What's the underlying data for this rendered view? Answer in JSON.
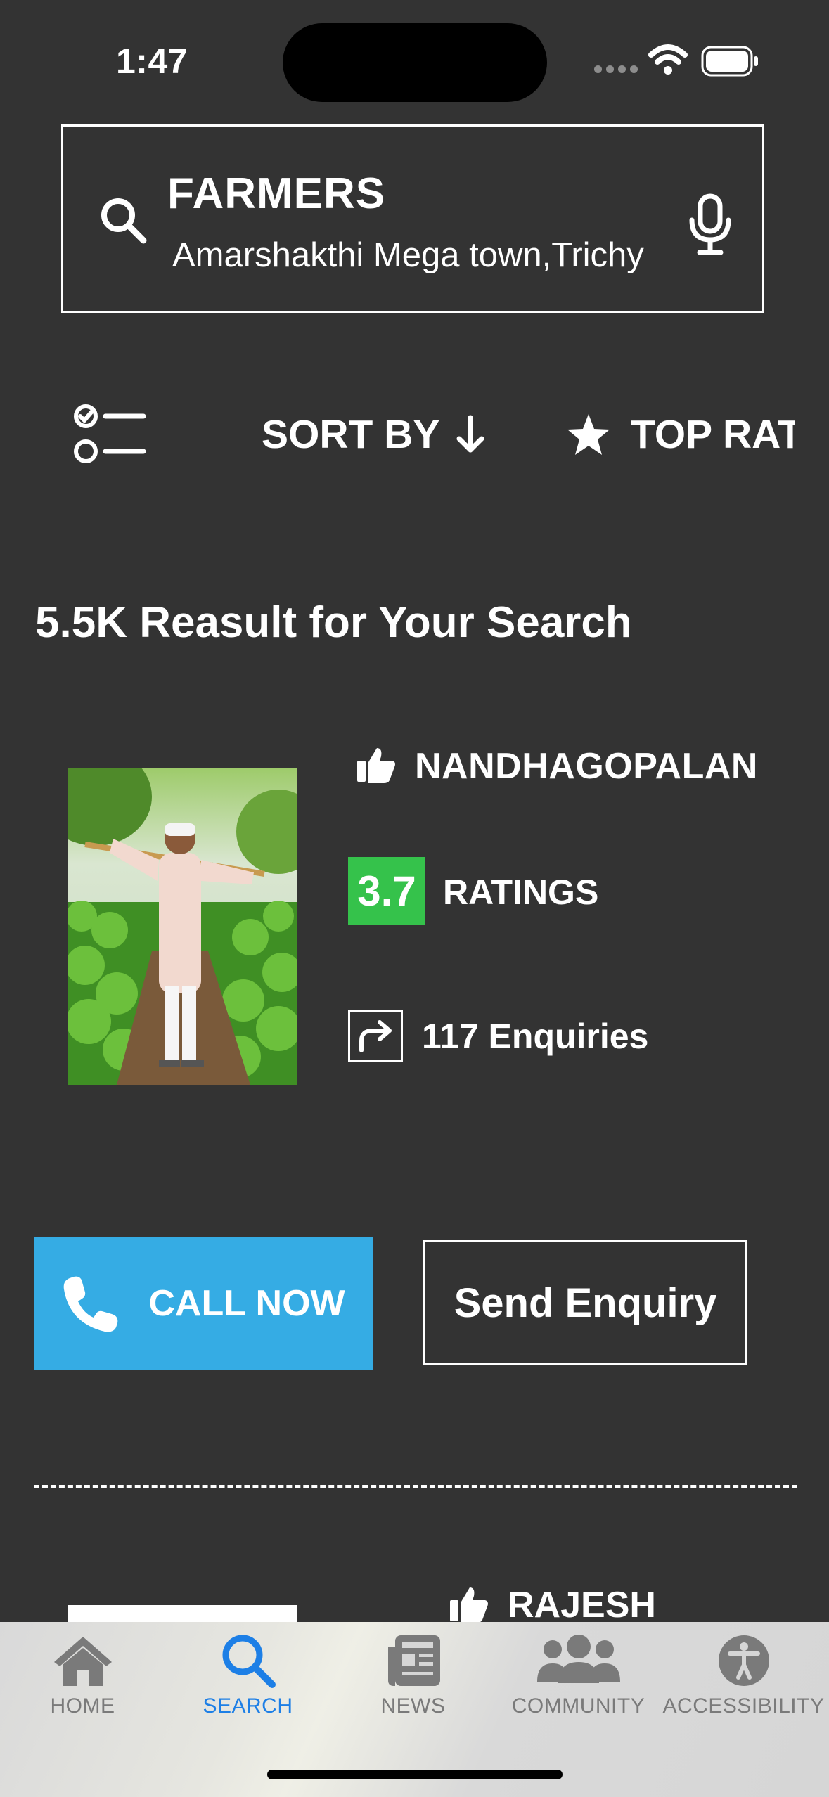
{
  "status_bar": {
    "time": "1:47"
  },
  "search": {
    "title": "FARMERS",
    "location": "Amarshakthi Mega town,Trichy",
    "icons": [
      "search-icon",
      "microphone-icon"
    ]
  },
  "filters": {
    "filter_icon": "checklist-icon",
    "sort_by": "SORT BY",
    "top_rated": "TOP RAT"
  },
  "results_text": "5.5K Reasult for Your Search",
  "listings": [
    {
      "name": "NANDHAGOPALAN",
      "rating": "3.7",
      "ratings_label": "RATINGS",
      "enquiries": "117 Enquiries",
      "call_label": "CALL NOW",
      "enquiry_label": "Send Enquiry"
    },
    {
      "name": "RAJESH"
    }
  ],
  "tabs": [
    {
      "label": "HOME",
      "icon": "home-icon"
    },
    {
      "label": "SEARCH",
      "icon": "search-icon"
    },
    {
      "label": "NEWS",
      "icon": "newspaper-icon"
    },
    {
      "label": "COMMUNITY",
      "icon": "community-icon"
    },
    {
      "label": "ACCESSIBILITY",
      "icon": "accessibility-icon"
    }
  ],
  "colors": {
    "background": "#333333",
    "rating_badge": "#35c24b",
    "call_button": "#35ace4",
    "active_tab": "#1d7fe6",
    "inactive_tab": "#7a7a7a"
  }
}
